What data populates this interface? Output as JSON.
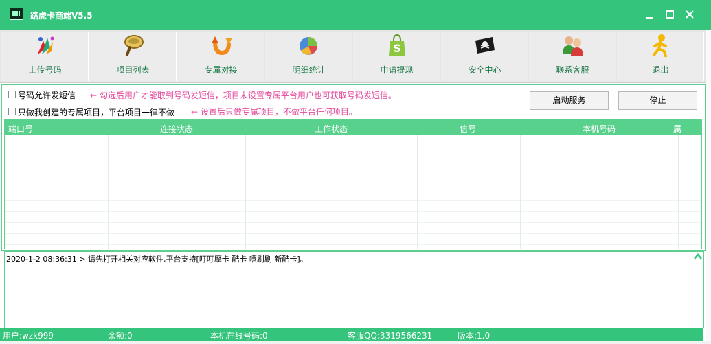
{
  "window": {
    "title": "路虎卡商端V5.5",
    "minimize_label": "━",
    "maximize_label": "☐",
    "close_label": "✕"
  },
  "toolbar": [
    {
      "label": "上传号码",
      "icon": "upload-numbers-icon"
    },
    {
      "label": "项目列表",
      "icon": "magnifier-icon"
    },
    {
      "label": "专属对接",
      "icon": "refresh-arrow-icon"
    },
    {
      "label": "明细统计",
      "icon": "pie-chart-icon"
    },
    {
      "label": "申请提现",
      "icon": "shopping-bag-icon"
    },
    {
      "label": "安全中心",
      "icon": "pirate-flag-icon"
    },
    {
      "label": "联系客服",
      "icon": "users-icon"
    },
    {
      "label": "退出",
      "icon": "running-man-icon"
    }
  ],
  "options": {
    "allow_sms": {
      "label": "号码允许发短信",
      "checked": false
    },
    "only_exclusive": {
      "label": "只做我创建的专属项目，平台项目一律不做",
      "checked": false
    },
    "note1": "← 勾选后用户才能取到号码发短信，项目未设置专属平台用户也可获取号码发短信。",
    "note2": "← 设置后只做专属项目，不做平台任何项目。"
  },
  "buttons": {
    "start": "启动服务",
    "stop": "停止"
  },
  "table": {
    "columns": [
      "端口号",
      "连接状态",
      "工作状态",
      "信号",
      "本机号码",
      "属"
    ],
    "rows": []
  },
  "log": {
    "lines": [
      "2020-1-2 08:36:31 > 请先打开相关对应软件,平台支持[叮叮摩卡 酷卡 嘻刷刷 新酷卡]。"
    ]
  },
  "status": {
    "user": "用户:wzk999",
    "balance": "余额:0",
    "online": "本机在线号码:0",
    "qq": "客服QQ:3319566231",
    "version": "版本:1.0"
  },
  "colors": {
    "accent": "#35c47c",
    "header": "#58d18d",
    "note": "#e2499b",
    "toolbar_label": "#1f7a4a"
  }
}
